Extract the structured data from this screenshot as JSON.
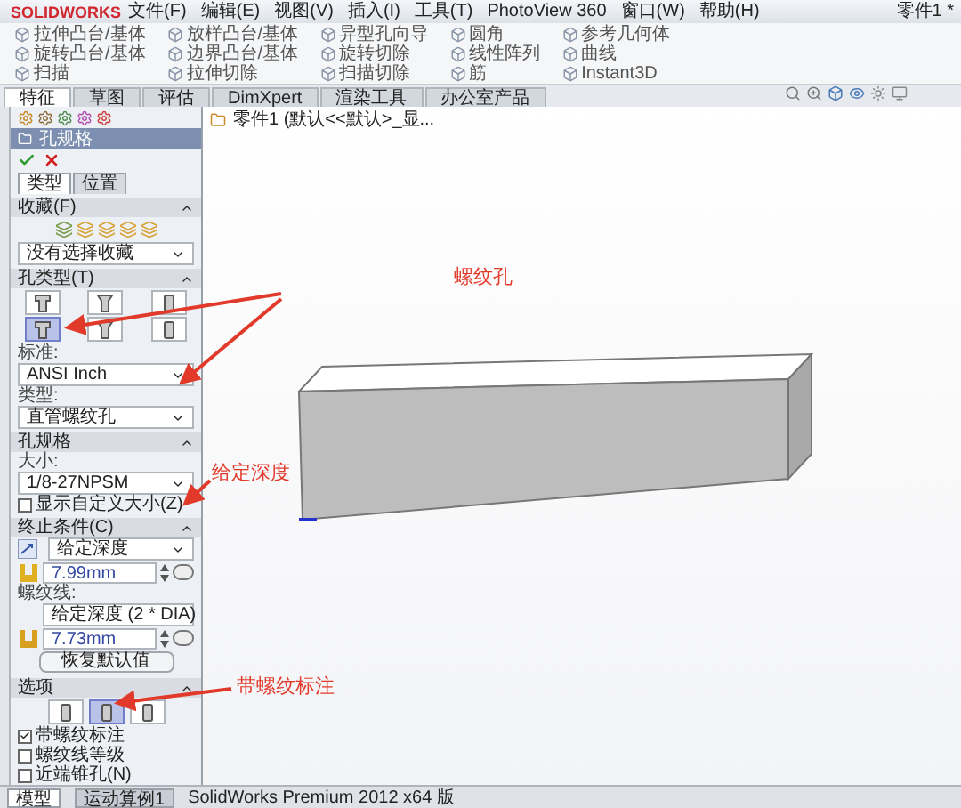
{
  "app": {
    "logo": "SOLIDWORKS",
    "document_title": "零件1 *"
  },
  "menu": [
    "文件(F)",
    "编辑(E)",
    "视图(V)",
    "插入(I)",
    "工具(T)",
    "PhotoView 360",
    "窗口(W)",
    "帮助(H)"
  ],
  "ribbon_columns": [
    {
      "buttons": [
        "拉伸凸台/基体",
        "旋转凸台/基体",
        "扫描"
      ]
    },
    {
      "buttons": [
        "放样凸台/基体",
        "边界凸台/基体",
        "拉伸切除"
      ]
    },
    {
      "buttons": [
        "异型孔向导",
        "旋转切除",
        "扫描切除"
      ]
    },
    {
      "buttons": [
        "圆角",
        "线性阵列",
        "筋"
      ]
    },
    {
      "buttons": [
        "参考几何体",
        "曲线",
        "Instant3D"
      ]
    }
  ],
  "feature_tabs": [
    {
      "label": "特征",
      "selected": true
    },
    {
      "label": "草图",
      "selected": false
    },
    {
      "label": "评估",
      "selected": false
    },
    {
      "label": "DimXpert",
      "selected": false
    },
    {
      "label": "渲染工具",
      "selected": false
    },
    {
      "label": "办公室产品",
      "selected": false
    }
  ],
  "tree_path": "零件1 (默认<<默认>_显...",
  "property_manager": {
    "title": "孔规格",
    "tabs": [
      {
        "label": "类型",
        "selected": true
      },
      {
        "label": "位置",
        "selected": false
      }
    ],
    "favorites": {
      "header": "收藏(F)",
      "dropdown": "没有选择收藏"
    },
    "hole_type": {
      "header": "孔类型(T)",
      "types": [
        {
          "selected": false
        },
        {
          "selected": false
        },
        {
          "selected": false
        },
        {
          "selected": true
        },
        {
          "selected": false
        },
        {
          "selected": false
        }
      ],
      "standard_label": "标准:",
      "standard": "ANSI Inch",
      "type_label": "类型:",
      "type": "直管螺纹孔"
    },
    "hole_spec": {
      "header": "孔规格",
      "size_label": "大小:",
      "size": "1/8-27NPSM",
      "custom_size": {
        "label": "显示自定义大小(Z)",
        "checked": false
      }
    },
    "end_condition": {
      "header": "终止条件(C)",
      "condition": "给定深度",
      "depth": "7.99mm",
      "thread_label": "螺纹线:",
      "thread_condition": "给定深度 (2 * DIA)",
      "thread_depth": "7.73mm",
      "restore_button": "恢复默认值"
    },
    "options": {
      "header": "选项",
      "styles": [
        {
          "selected": false
        },
        {
          "selected": true
        },
        {
          "selected": false
        }
      ],
      "checkboxes": [
        {
          "label": "带螺纹标注",
          "checked": true
        },
        {
          "label": "螺纹线等级",
          "checked": false
        },
        {
          "label": "近端锥孔(N)",
          "checked": false
        }
      ]
    }
  },
  "annotations": [
    {
      "text": "螺纹孔"
    },
    {
      "text": "给定深度"
    },
    {
      "text": "带螺纹标注"
    }
  ],
  "bottom_tabs": [
    {
      "label": "模型",
      "selected": true
    },
    {
      "label": "运动算例1",
      "selected": false
    }
  ],
  "status_bar": "SolidWorks Premium 2012 x64 版"
}
